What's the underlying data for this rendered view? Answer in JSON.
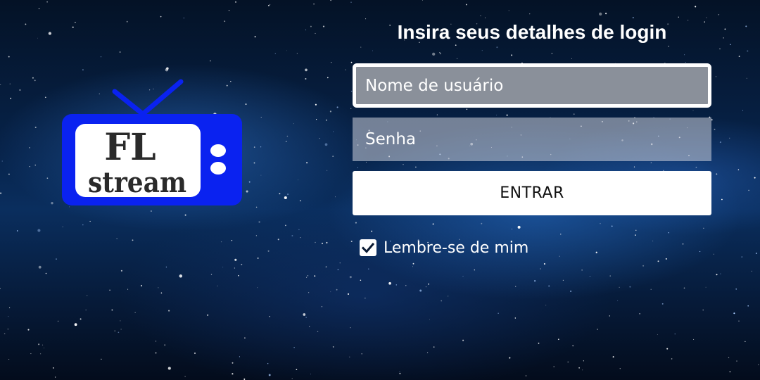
{
  "logo": {
    "line1": "FL",
    "line2": "stream"
  },
  "login": {
    "title": "Insira seus detalhes de login",
    "username": {
      "placeholder": "Nome de usuário",
      "value": ""
    },
    "password": {
      "placeholder": "Senha",
      "value": ""
    },
    "submit_label": "ENTRAR",
    "remember": {
      "label": "Lembre-se de mim",
      "checked": true
    }
  },
  "colors": {
    "logo_blue": "#0a22f0",
    "panel_white": "#ffffff",
    "background_deep": "#061a38"
  },
  "icons": {
    "checkbox": "checkmark-icon"
  }
}
